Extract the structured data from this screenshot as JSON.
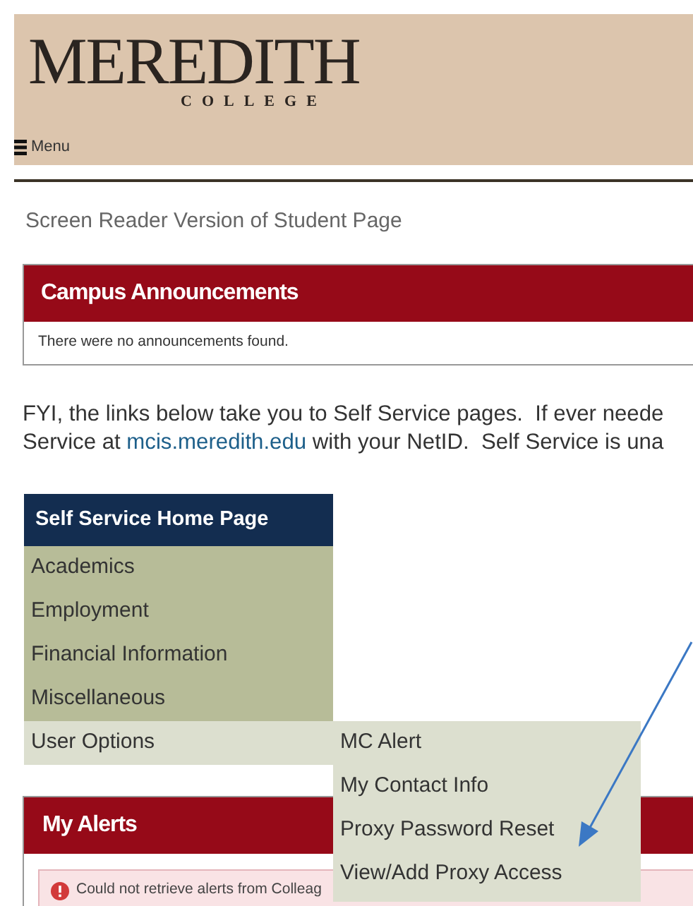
{
  "header": {
    "logo_title": "MEREDITH",
    "logo_subtitle": "COLLEGE",
    "menu_label": "Menu"
  },
  "page_title": "Screen Reader Version of Student Page",
  "announcements": {
    "title": "Campus Announcements",
    "message": "There were no announcements found."
  },
  "intro": {
    "line_1": "FYI, the links below take you to Self Service pages.  If ever neede",
    "line_2_before": "Service at ",
    "link": "mcis.meredith.edu",
    "line_2_after": " with your NetID.  Self Service is una"
  },
  "self_service_menu": {
    "title": "Self Service Home Page",
    "items": [
      {
        "label": "Academics",
        "selected": false
      },
      {
        "label": "Employment",
        "selected": false
      },
      {
        "label": "Financial Information",
        "selected": false
      },
      {
        "label": "Miscellaneous",
        "selected": false
      },
      {
        "label": "User Options",
        "selected": true,
        "children": [
          {
            "label": "MC Alert"
          },
          {
            "label": "My Contact Info"
          },
          {
            "label": "Proxy Password Reset"
          },
          {
            "label": "View/Add Proxy Access"
          }
        ]
      }
    ]
  },
  "alerts": {
    "title": "My Alerts",
    "message": "Could not retrieve alerts from Colleag"
  }
}
